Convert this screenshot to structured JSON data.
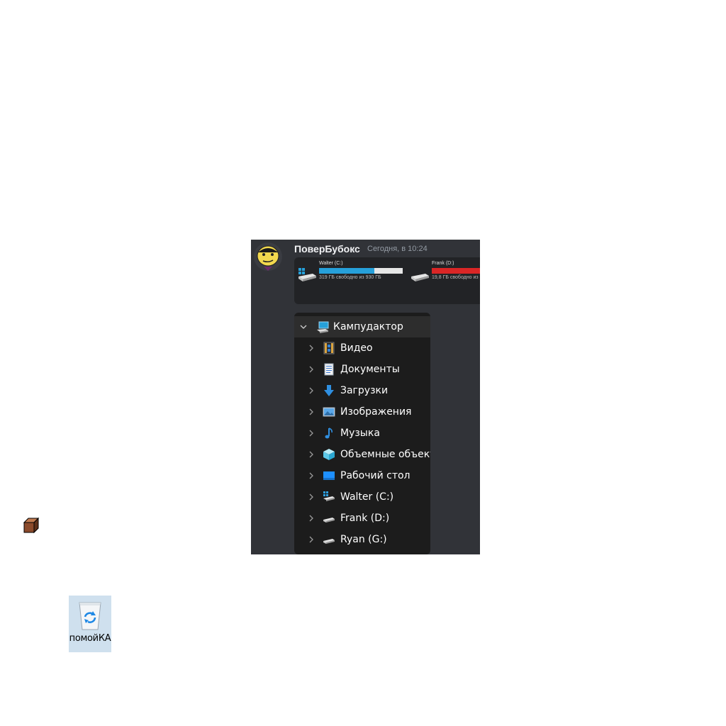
{
  "desktop": {
    "cube_icon": "box-icon",
    "recycle_bin": {
      "icon": "recycle-bin-icon",
      "label": "помойКА"
    }
  },
  "chat": {
    "username": "ПоверБубокс",
    "timestamp": "Сегодня, в 10:24",
    "drives": [
      {
        "name": "Walter (C:)",
        "free": "319 ГБ свободно из 930 ГБ",
        "used_fraction": 0.66,
        "bar_color": "#26a0da"
      },
      {
        "name": "Frank (D:)",
        "free": "19,8 ГБ свободно из",
        "used_fraction": 0.98,
        "bar_color": "#da2626"
      }
    ],
    "tree": {
      "root": {
        "label": "Кампудактор",
        "icon": "computer-icon"
      },
      "items": [
        {
          "label": "Видео",
          "icon": "video-icon"
        },
        {
          "label": "Документы",
          "icon": "documents-icon"
        },
        {
          "label": "Загрузки",
          "icon": "downloads-icon"
        },
        {
          "label": "Изображения",
          "icon": "pictures-icon"
        },
        {
          "label": "Музыка",
          "icon": "music-icon"
        },
        {
          "label": "Объемные объект",
          "icon": "3d-objects-icon"
        },
        {
          "label": "Рабочий стол",
          "icon": "desktop-icon"
        },
        {
          "label": "Walter (C:)",
          "icon": "windows-drive-icon"
        },
        {
          "label": "Frank (D:)",
          "icon": "drive-icon"
        },
        {
          "label": "Ryan (G:)",
          "icon": "drive-icon"
        }
      ]
    }
  }
}
